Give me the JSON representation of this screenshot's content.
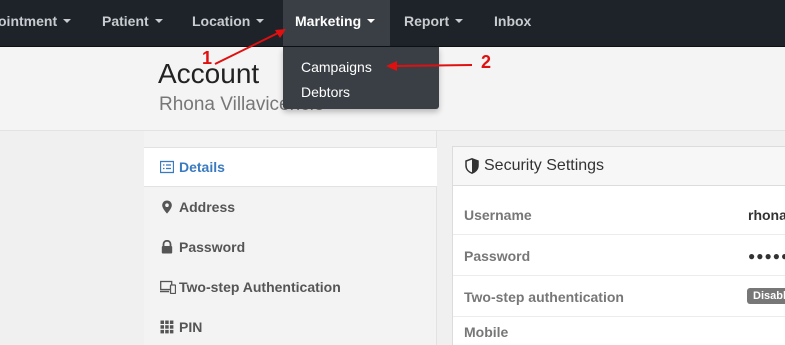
{
  "navbar": {
    "items": [
      {
        "label": "ointment"
      },
      {
        "label": "Patient"
      },
      {
        "label": "Location"
      },
      {
        "label": "Marketing"
      },
      {
        "label": "Report"
      },
      {
        "label": "Inbox"
      }
    ]
  },
  "dropdown": {
    "items": [
      {
        "label": "Campaigns"
      },
      {
        "label": "Debtors"
      }
    ]
  },
  "header": {
    "title": "Account",
    "subtitle": "Rhona Villavicencio"
  },
  "sidebar": {
    "items": [
      {
        "label": "Details",
        "icon": "list-icon"
      },
      {
        "label": "Address",
        "icon": "map-marker-icon"
      },
      {
        "label": "Password",
        "icon": "lock-icon"
      },
      {
        "label": "Two-step Authentication",
        "icon": "devices-icon"
      },
      {
        "label": "PIN",
        "icon": "keypad-icon"
      }
    ]
  },
  "security": {
    "title": "Security Settings",
    "rows": [
      {
        "key": "Username",
        "value": "rhona"
      },
      {
        "key": "Password",
        "value": "●●●●●"
      },
      {
        "key": "Two-step authentication",
        "value": "Disabled"
      },
      {
        "key": "Mobile",
        "value": ""
      }
    ]
  },
  "annotations": {
    "label1": "1",
    "label2": "2"
  },
  "colors": {
    "navbar_bg": "#1e2329",
    "active_nav_bg": "#3a3f45",
    "link_blue": "#3a7bc0",
    "annotation_red": "#e01010"
  }
}
